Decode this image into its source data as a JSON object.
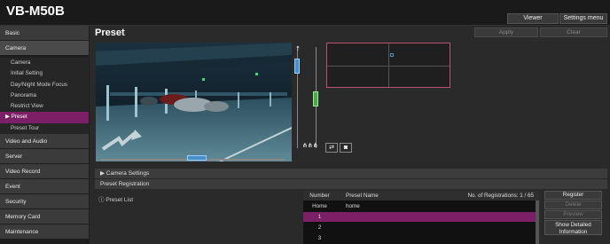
{
  "header": {
    "brand": "VB-M50B",
    "viewer_label": "Viewer",
    "settings_menu_label": "Settings menu"
  },
  "sidebar": {
    "sections": [
      {
        "label": "Basic"
      },
      {
        "label": "Camera"
      },
      {
        "label": "Video and Audio"
      },
      {
        "label": "Server"
      },
      {
        "label": "Video Record"
      },
      {
        "label": "Event"
      },
      {
        "label": "Security"
      },
      {
        "label": "Memory Card"
      },
      {
        "label": "Maintenance"
      }
    ],
    "camera_items": [
      {
        "label": "Camera"
      },
      {
        "label": "Initial Setting"
      },
      {
        "label": "Day/Night Mode Focus"
      },
      {
        "label": "Panorama"
      },
      {
        "label": "Restrict View"
      },
      {
        "label": "▶ Preset"
      },
      {
        "label": "Preset Tour"
      }
    ]
  },
  "main": {
    "title": "Preset",
    "apply_label": "Apply",
    "clear_label": "Clear",
    "camera_settings_label": "▶  Camera Settings",
    "preset_registration_label": "Preset Registration",
    "preset_list_label": "Preset List"
  },
  "preset_table": {
    "col_number": "Number",
    "col_name": "Preset Name",
    "registrations": "No. of Registrations: 1 / 65",
    "rows": [
      {
        "number": "Home",
        "name": "home"
      },
      {
        "number": "1",
        "name": ""
      },
      {
        "number": "2",
        "name": ""
      },
      {
        "number": "3",
        "name": ""
      }
    ]
  },
  "side_buttons": {
    "register": "Register",
    "delete": "Delete",
    "preview": "Preview",
    "show_detail_1": "Show Detailed",
    "show_detail_2": "Information"
  },
  "colors": {
    "accent": "#7b1f66",
    "zoom": "#4a90c8",
    "focus": "#4aa84a",
    "overview_border": "#b8546f"
  }
}
